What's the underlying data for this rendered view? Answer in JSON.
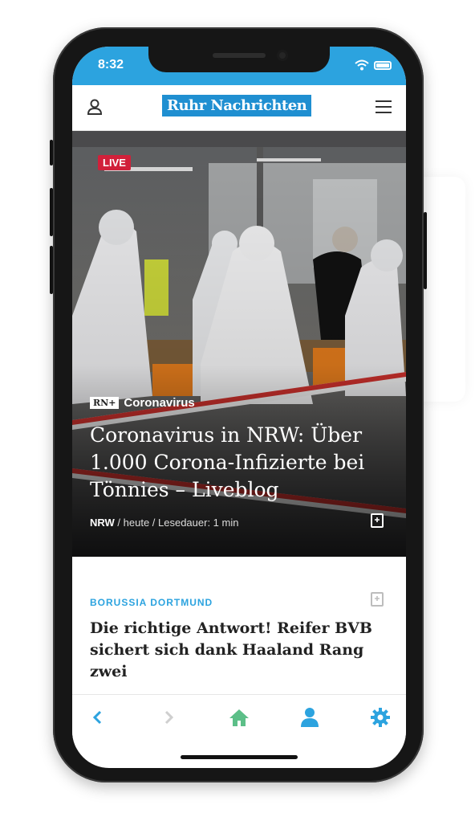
{
  "status": {
    "time": "8:32"
  },
  "header": {
    "logo": "Ruhr Nachrichten"
  },
  "hero": {
    "badge": "LIVE",
    "rn_plus": "RN+",
    "category": "Coronavirus",
    "title": "Coronavirus in NRW: Über 1.000 Corona-Infizierte bei Tönnies – Liveblog",
    "meta_region": "NRW",
    "meta_rest": " / heute / Lesedauer: 1 min"
  },
  "article": {
    "category": "BORUSSIA DORTMUND",
    "title": "Die richtige Antwort! Reifer BVB sichert sich dank Haaland Rang zwei"
  },
  "colors": {
    "accent": "#2ca3df",
    "live": "#d1203a",
    "home": "#5cbf88"
  },
  "icons": [
    "profile-icon",
    "menu-icon",
    "bookmark-icon",
    "back-icon",
    "forward-icon",
    "home-icon",
    "user-icon",
    "settings-icon"
  ]
}
